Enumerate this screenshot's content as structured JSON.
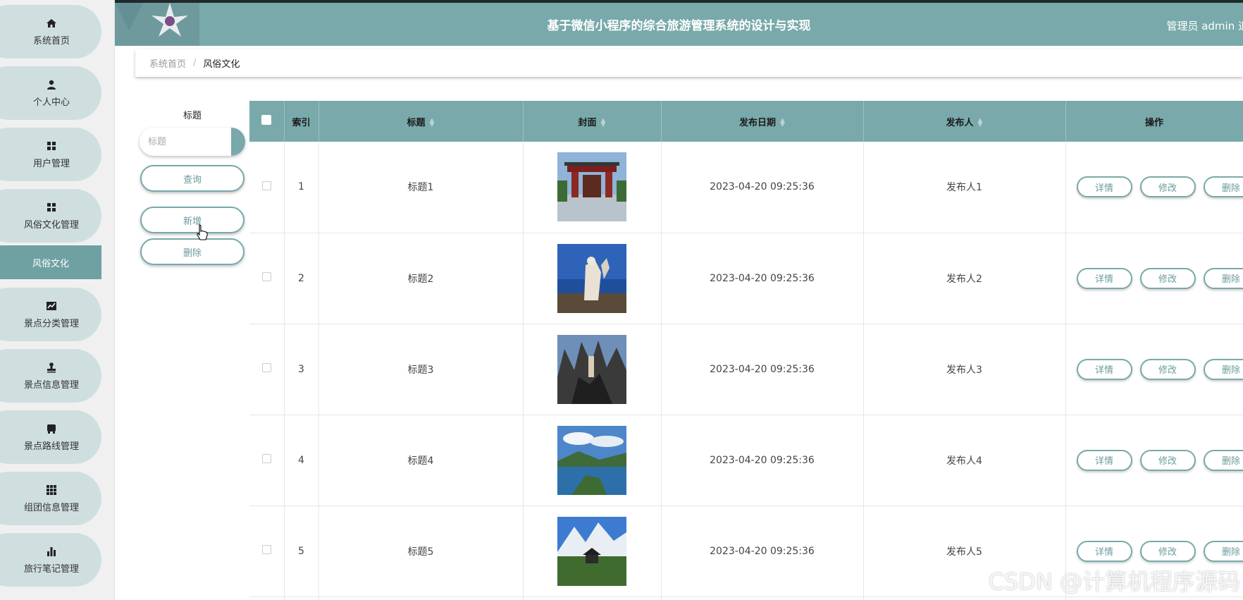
{
  "header": {
    "title": "基于微信小程序的综合旅游管理系统的设计与实现",
    "user": "管理员 admin  退"
  },
  "sidebar": {
    "items": [
      {
        "label": "系统首页",
        "icon": "home-icon"
      },
      {
        "label": "个人中心",
        "icon": "user-icon"
      },
      {
        "label": "用户管理",
        "icon": "grid-icon"
      },
      {
        "label": "风俗文化管理",
        "icon": "grid-icon"
      },
      {
        "label": "景点分类管理",
        "icon": "chart-icon"
      },
      {
        "label": "景点信息管理",
        "icon": "stamp-icon"
      },
      {
        "label": "景点路线管理",
        "icon": "bus-icon"
      },
      {
        "label": "组团信息管理",
        "icon": "apps-icon"
      },
      {
        "label": "旅行笔记管理",
        "icon": "bar-chart-icon"
      }
    ],
    "active_sub": "风俗文化"
  },
  "breadcrumb": {
    "home": "系统首页",
    "sep": "/",
    "current": "风俗文化"
  },
  "search": {
    "label": "标题",
    "placeholder": "标题",
    "query_btn": "查询",
    "add_btn": "新增",
    "delete_btn": "删除"
  },
  "table": {
    "columns": {
      "index": "索引",
      "title": "标题",
      "cover": "封面",
      "date": "发布日期",
      "publisher": "发布人",
      "ops": "操作"
    },
    "rows": [
      {
        "index": "1",
        "title": "标题1",
        "date": "2023-04-20 09:25:36",
        "publisher": "发布人1",
        "cover": "gate-photo"
      },
      {
        "index": "2",
        "title": "标题2",
        "date": "2023-04-20 09:25:36",
        "publisher": "发布人2",
        "cover": "statue-photo"
      },
      {
        "index": "3",
        "title": "标题3",
        "date": "2023-04-20 09:25:36",
        "publisher": "发布人3",
        "cover": "rocks-photo"
      },
      {
        "index": "4",
        "title": "标题4",
        "date": "2023-04-20 09:25:36",
        "publisher": "发布人4",
        "cover": "lake-photo"
      },
      {
        "index": "5",
        "title": "标题5",
        "date": "2023-04-20 09:25:36",
        "publisher": "发布人5",
        "cover": "mountain-photo"
      }
    ],
    "actions": {
      "detail": "详情",
      "edit": "修改",
      "delete": "删除"
    }
  },
  "watermark": "CSDN @计算机程序源码",
  "colors": {
    "accent": "#79a9aa",
    "nav_bg": "#cfdfdf",
    "active_sub": "#6fa1a3"
  }
}
